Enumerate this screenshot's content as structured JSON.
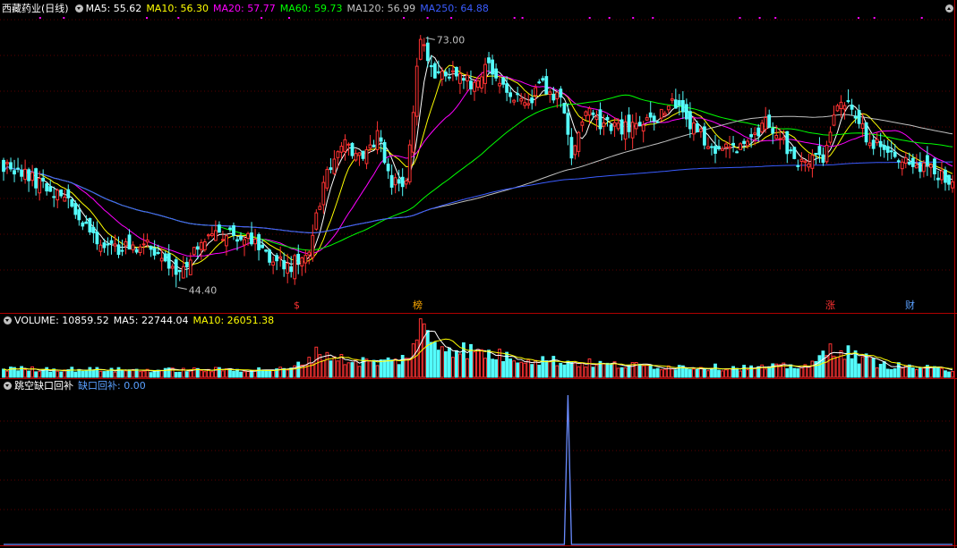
{
  "price_header": {
    "title": "西藏药业(日线)",
    "indicators": [
      {
        "label": "MA5: 55.62",
        "color": "#ffffff"
      },
      {
        "label": "MA10: 56.30",
        "color": "#ffff00"
      },
      {
        "label": "MA20: 57.77",
        "color": "#ff00ff"
      },
      {
        "label": "MA60: 59.73",
        "color": "#00ff00"
      },
      {
        "label": "MA120: 56.99",
        "color": "#c0c0c0"
      },
      {
        "label": "MA250: 64.88",
        "color": "#3a5cff"
      }
    ]
  },
  "volume_header": {
    "indicators": [
      {
        "label": "VOLUME: 10859.52",
        "color": "#ffffff"
      },
      {
        "label": "MA5: 22744.04",
        "color": "#ffffff"
      },
      {
        "label": "MA10: 26051.38",
        "color": "#ffff00"
      }
    ]
  },
  "gap_header": {
    "title": "跳空缺口回补",
    "indicator": "缺口回补: 0.00",
    "indicator_color": "#5aa0ff"
  },
  "colors": {
    "up": "#ff3232",
    "down": "#54fcfc",
    "frame": "#b00000",
    "gap_line": "#6a8cff"
  },
  "event_markers": [
    {
      "label": "$",
      "color": "#ff3232",
      "index": 82
    },
    {
      "label": "榜",
      "color": "#ffaa00",
      "index": 115
    },
    {
      "label": "涨",
      "color": "#ff3232",
      "index": 230
    },
    {
      "label": "财",
      "color": "#5aa0ff",
      "index": 252
    }
  ],
  "chart_data": [
    {
      "type": "candlestick",
      "panel": "price",
      "high_label": "73.00",
      "low_label": "44.40",
      "high_index": 117,
      "low_index": 48,
      "y_range": [
        42.5,
        75.5
      ],
      "bar_count": 265,
      "keypoints": [
        [
          0,
          58.5
        ],
        [
          8,
          56.8
        ],
        [
          18,
          54.5
        ],
        [
          25,
          50.0
        ],
        [
          33,
          48.8
        ],
        [
          40,
          49.5
        ],
        [
          48,
          45.6
        ],
        [
          55,
          49.8
        ],
        [
          62,
          50.8
        ],
        [
          68,
          50.1
        ],
        [
          74,
          47.5
        ],
        [
          80,
          47.0
        ],
        [
          85,
          49.0
        ],
        [
          90,
          58.0
        ],
        [
          95,
          61.0
        ],
        [
          100,
          59.0
        ],
        [
          104,
          62.0
        ],
        [
          108,
          56.0
        ],
        [
          112,
          57.0
        ],
        [
          116,
          73.0
        ],
        [
          120,
          68.5
        ],
        [
          125,
          69.0
        ],
        [
          130,
          67.8
        ],
        [
          135,
          70.0
        ],
        [
          140,
          66.5
        ],
        [
          145,
          65.5
        ],
        [
          150,
          67.5
        ],
        [
          155,
          66.0
        ],
        [
          158,
          60.0
        ],
        [
          162,
          64.5
        ],
        [
          167,
          63.0
        ],
        [
          172,
          62.5
        ],
        [
          177,
          63.0
        ],
        [
          182,
          64.0
        ],
        [
          186,
          65.5
        ],
        [
          192,
          62.5
        ],
        [
          198,
          60.5
        ],
        [
          203,
          60.5
        ],
        [
          208,
          61.0
        ],
        [
          212,
          63.5
        ],
        [
          216,
          62.0
        ],
        [
          220,
          58.5
        ],
        [
          224,
          59.0
        ],
        [
          228,
          59.0
        ],
        [
          232,
          65.5
        ],
        [
          236,
          65.0
        ],
        [
          240,
          61.5
        ],
        [
          245,
          60.0
        ],
        [
          250,
          59.5
        ],
        [
          255,
          58.0
        ],
        [
          260,
          57.5
        ],
        [
          264,
          56.8
        ]
      ],
      "ma_series": [
        {
          "name": "MA5",
          "period": 5,
          "color": "#ffffff"
        },
        {
          "name": "MA10",
          "period": 10,
          "color": "#ffff00"
        },
        {
          "name": "MA20",
          "period": 20,
          "color": "#ff00ff"
        },
        {
          "name": "MA60",
          "period": 60,
          "color": "#00ff00"
        },
        {
          "name": "MA120",
          "period": 120,
          "color": "#c0c0c0"
        },
        {
          "name": "MA250",
          "period": 250,
          "color": "#3a5cff"
        }
      ]
    },
    {
      "type": "bar",
      "panel": "volume",
      "y_range": [
        0,
        54000
      ],
      "keypoints": [
        [
          0,
          9000
        ],
        [
          40,
          7500
        ],
        [
          80,
          8500
        ],
        [
          88,
          27000
        ],
        [
          95,
          18000
        ],
        [
          105,
          16000
        ],
        [
          112,
          20000
        ],
        [
          116,
          52000
        ],
        [
          120,
          37000
        ],
        [
          130,
          28000
        ],
        [
          140,
          22000
        ],
        [
          155,
          17000
        ],
        [
          170,
          13000
        ],
        [
          190,
          11000
        ],
        [
          210,
          10000
        ],
        [
          225,
          13000
        ],
        [
          231,
          34000
        ],
        [
          236,
          24000
        ],
        [
          245,
          13000
        ],
        [
          264,
          7500
        ]
      ],
      "ma_series": [
        {
          "name": "MA5",
          "period": 5,
          "color": "#ffffff"
        },
        {
          "name": "MA10",
          "period": 10,
          "color": "#ffff00"
        }
      ]
    },
    {
      "type": "line",
      "panel": "gap_fill",
      "y_range": [
        0,
        1
      ],
      "values_sparse": [
        [
          157,
          1
        ]
      ],
      "color": "#6a8cff"
    }
  ]
}
